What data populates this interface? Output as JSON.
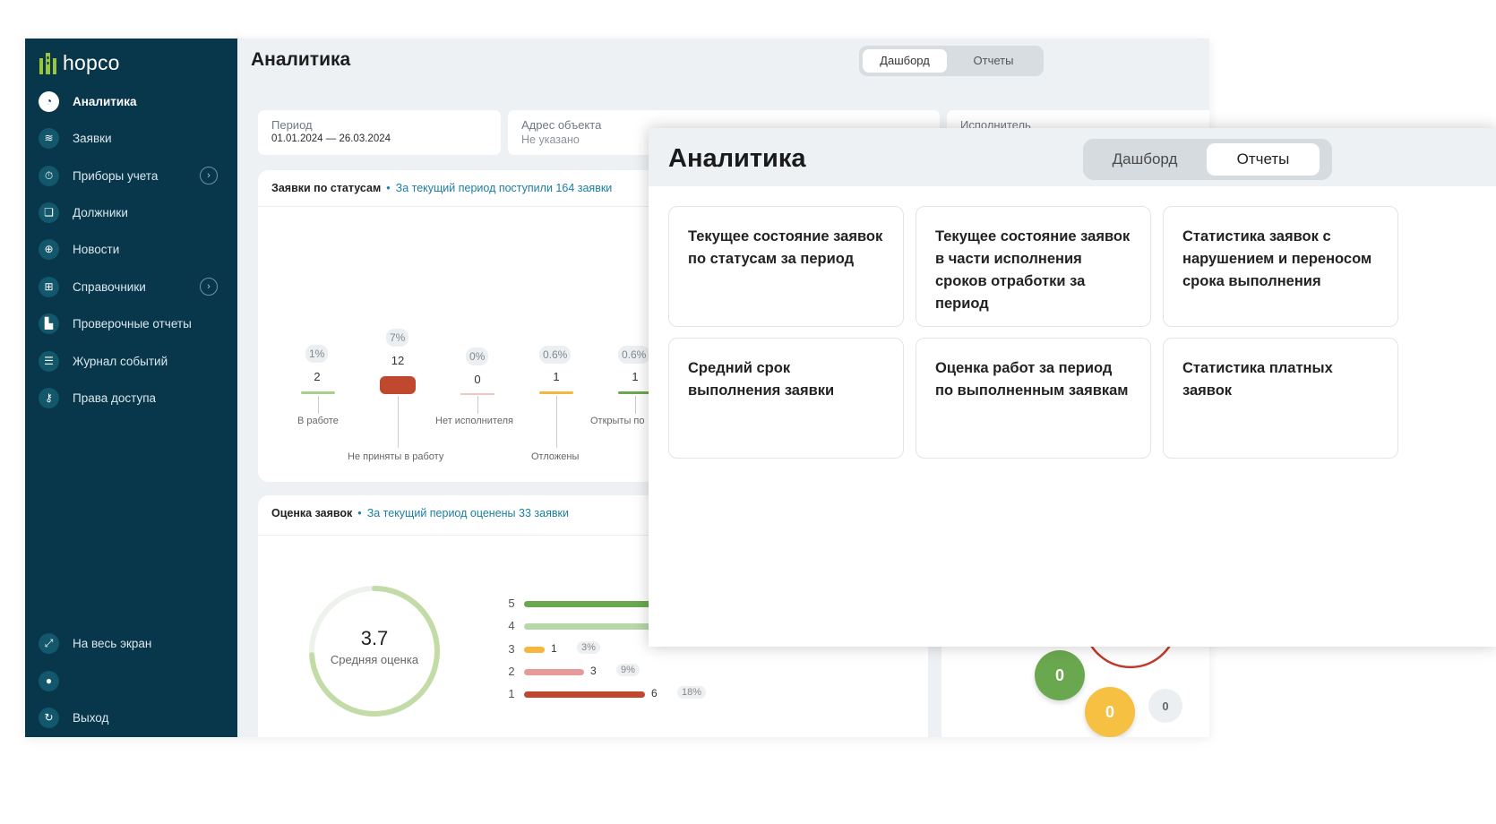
{
  "back": {
    "brand": "hopco",
    "nav": [
      {
        "label": "Аналитика",
        "icon": "pie-chart-icon",
        "active": true
      },
      {
        "label": "Заявки",
        "icon": "layers-icon"
      },
      {
        "label": "Приборы учета",
        "icon": "stopwatch-icon",
        "expandable": true
      },
      {
        "label": "Должники",
        "icon": "coins-icon"
      },
      {
        "label": "Новости",
        "icon": "globe-icon"
      },
      {
        "label": "Справочники",
        "icon": "grid-icon",
        "expandable": true
      },
      {
        "label": "Проверочные отчеты",
        "icon": "chart-report-icon"
      },
      {
        "label": "Журнал событий",
        "icon": "list-icon"
      },
      {
        "label": "Права доступа",
        "icon": "key-icon"
      }
    ],
    "bottom_nav": [
      {
        "label": "На весь экран",
        "icon": "fullscreen-icon"
      },
      {
        "label": "",
        "icon": "user-icon"
      },
      {
        "label": "Выход",
        "icon": "logout-icon"
      }
    ],
    "title": "Аналитика",
    "tabs": [
      "Дашборд",
      "Отчеты"
    ],
    "active_tab": "Дашборд",
    "filters": {
      "period_label": "Период",
      "period_value": "01.01.2024 — 26.03.2024",
      "address_label": "Адрес объекта",
      "address_value": "Не указано",
      "executor_label": "Исполнитель"
    },
    "status_card": {
      "title": "Заявки по статусам",
      "subtitle": "За текущий период поступили 164 заявки",
      "items": [
        {
          "pct": "1%",
          "count": "2",
          "label": "В работе",
          "color": "#a8d08d"
        },
        {
          "pct": "7%",
          "count": "12",
          "label": "Не приняты в работу",
          "color": "#c0482f"
        },
        {
          "pct": "0%",
          "count": "0",
          "label": "Нет исполнителя",
          "color": "#f2c4c4"
        },
        {
          "pct": "0.6%",
          "count": "1",
          "label": "Отложены",
          "color": "#f6b73c"
        },
        {
          "pct": "0.6%",
          "count": "1",
          "label": "Открыты по",
          "color": "#6aa84f"
        }
      ]
    },
    "rating_card": {
      "title": "Оценка заявок",
      "subtitle": "За текущий период оценены 33 заявки",
      "average": "3.7",
      "average_label": "Средняя оценка",
      "average_fraction": 0.74,
      "rows": [
        {
          "grade": "5",
          "count": "",
          "pct": "",
          "color": "#6aa84f"
        },
        {
          "grade": "4",
          "count": "",
          "pct": "",
          "color": "#b6d7a8"
        },
        {
          "grade": "3",
          "count": "1",
          "pct": "3%",
          "color": "#f6b73c"
        },
        {
          "grade": "2",
          "count": "3",
          "pct": "9%",
          "color": "#e89a9a"
        },
        {
          "grade": "1",
          "count": "6",
          "pct": "18%",
          "color": "#c0482f"
        }
      ]
    },
    "bubbles": [
      {
        "value": "0",
        "color": "#6aa84f"
      },
      {
        "value": "0",
        "color": "#f6c042"
      },
      {
        "value": "0",
        "color": "#eceff1"
      }
    ]
  },
  "front": {
    "title": "Аналитика",
    "tabs": [
      "Дашборд",
      "Отчеты"
    ],
    "active_tab": "Отчеты",
    "reports": [
      "Текущее состояние заявок по статусам за период",
      "Текущее состояние заявок в части исполнения сроков отработки за период",
      "Статистика заявок с нарушением и переносом срока выполнения",
      "Средний срок выполнения заявки",
      "Оценка работ за период по выполненным заявкам",
      "Статистика платных заявок"
    ]
  }
}
